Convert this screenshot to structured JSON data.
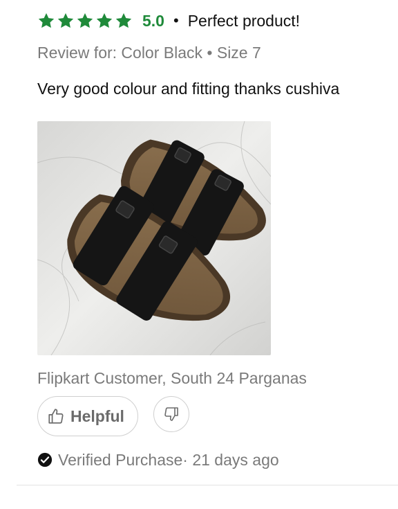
{
  "review": {
    "rating": {
      "stars": 5,
      "max_stars": 5,
      "score_text": "5.0",
      "star_color": "#1f8a3a",
      "star_icon": "star-icon"
    },
    "separator": "•",
    "headline": "Perfect product!",
    "variant_text": "Review for: Color Black • Size 7",
    "body": "Very good colour and fitting thanks cushiva",
    "photo": {
      "subject": "pair of black double-strap slide sandals on a marble floor",
      "icon": "product-photo"
    },
    "author": "Flipkart Customer, South 24 Parganas",
    "actions": {
      "helpful_label": "Helpful",
      "helpful_icon": "thumbs-up-icon",
      "dislike_icon": "thumbs-down-icon"
    },
    "verified": {
      "label": "Verified Purchase",
      "time": "· 21 days ago",
      "icon": "check-circle-icon"
    }
  }
}
